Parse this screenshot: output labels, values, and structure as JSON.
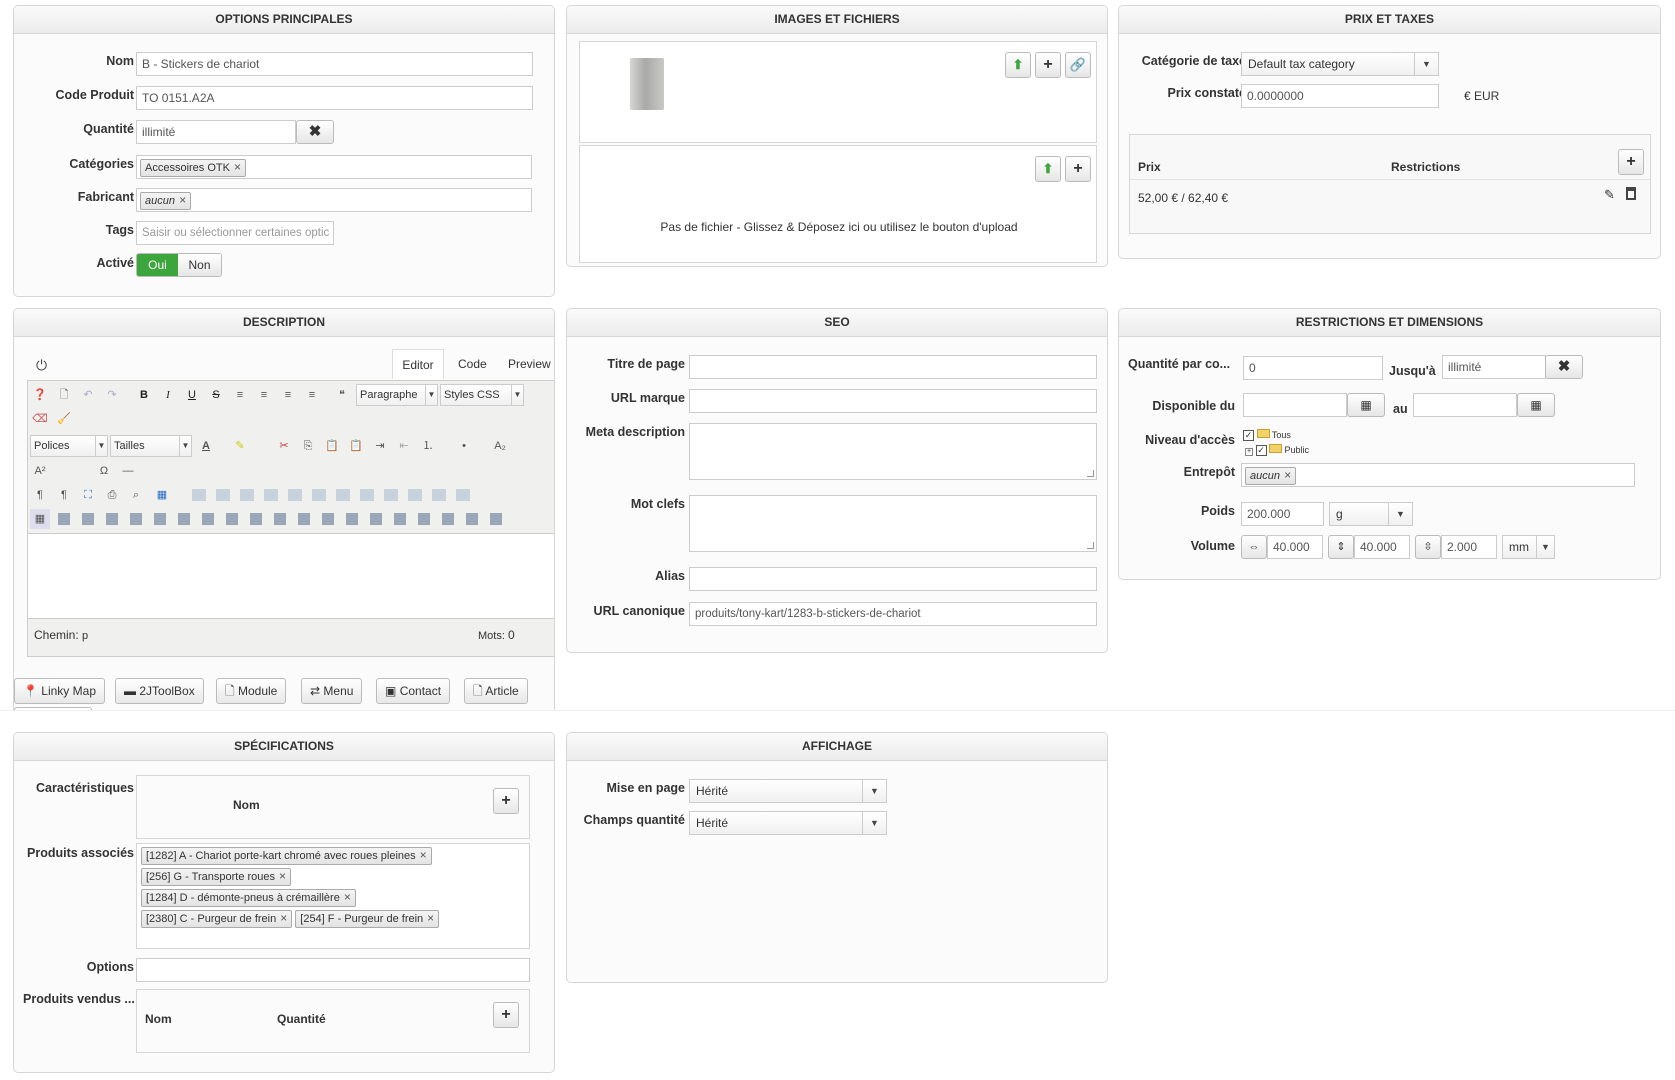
{
  "panels": {
    "main": "OPTIONS PRINCIPALES",
    "images": "IMAGES ET FICHIERS",
    "price": "PRIX ET TAXES",
    "description": "DESCRIPTION",
    "seo": "SEO",
    "restrictions": "RESTRICTIONS ET DIMENSIONS",
    "specs": "SPÉCIFICATIONS",
    "display": "AFFICHAGE"
  },
  "main": {
    "name_label": "Nom",
    "name_value": "B - Stickers de chariot",
    "code_label": "Code Produit",
    "code_value": "TO 0151.A2A",
    "qty_label": "Quantité",
    "qty_value": "illimité",
    "cat_label": "Catégories",
    "cat_tag": "Accessoires OTK",
    "maker_label": "Fabricant",
    "maker_tag": "aucun",
    "tags_label": "Tags",
    "tags_placeholder": "Saisir ou sélectionner certaines optic",
    "active_label": "Activé",
    "active_yes": "Oui",
    "active_no": "Non"
  },
  "images": {
    "no_file": "Pas de fichier - Glissez & Déposez ici ou utilisez le bouton d'upload"
  },
  "price": {
    "tax_label": "Catégorie de taxe",
    "tax_value": "Default tax category",
    "observed_label": "Prix constaté",
    "observed_value": "0.0000000",
    "currency": "€ EUR",
    "col_price": "Prix",
    "col_restrictions": "Restrictions",
    "row_price": "52,00 € / 62,40 €"
  },
  "description": {
    "tab_editor": "Editor",
    "tab_code": "Code",
    "tab_preview": "Preview",
    "format": "Paragraphe",
    "styles": "Styles CSS",
    "fonts": "Polices",
    "sizes": "Tailles",
    "path_label": "Chemin:",
    "path_value": "p",
    "words_label": "Mots:",
    "words_value": "0",
    "buttons": [
      "Linky Map",
      "2JToolBox",
      "Module",
      "Menu",
      "Contact",
      "Article"
    ]
  },
  "seo": {
    "title_label": "Titre de page",
    "brand_label": "URL marque",
    "meta_label": "Meta description",
    "keywords_label": "Mot clefs",
    "alias_label": "Alias",
    "canonical_label": "URL canonique",
    "canonical_value": "produits/tony-kart/1283-b-stickers-de-chariot"
  },
  "restrictions": {
    "qty_label": "Quantité par co...",
    "qty_value": "0",
    "until_label": "Jusqu'à",
    "until_value": "illimité",
    "available_label": "Disponible du",
    "to_label": "au",
    "access_label": "Niveau d'accès",
    "access_all": "Tous",
    "access_public": "Public",
    "warehouse_label": "Entrepôt",
    "warehouse_tag": "aucun",
    "weight_label": "Poids",
    "weight_value": "200.000",
    "weight_unit": "g",
    "volume_label": "Volume",
    "volume_w": "40.000",
    "volume_l": "40.000",
    "volume_h": "2.000",
    "volume_unit": "mm"
  },
  "specs": {
    "features_label": "Caractéristiques",
    "features_col": "Nom",
    "related_label": "Produits associés",
    "related": [
      "[1282] A - Chariot porte-kart chromé avec roues pleines",
      "[256] G - Transporte roues",
      "[1284] D - démonte-pneus à crémaillère",
      "[2380] C - Purgeur de frein",
      "[254] F - Purgeur de frein"
    ],
    "options_label": "Options",
    "sold_label": "Produits vendus ...",
    "sold_col_name": "Nom",
    "sold_col_qty": "Quantité"
  },
  "display": {
    "layout_label": "Mise en page",
    "layout_value": "Hérité",
    "qtyfield_label": "Champs quantité",
    "qtyfield_value": "Hérité"
  }
}
